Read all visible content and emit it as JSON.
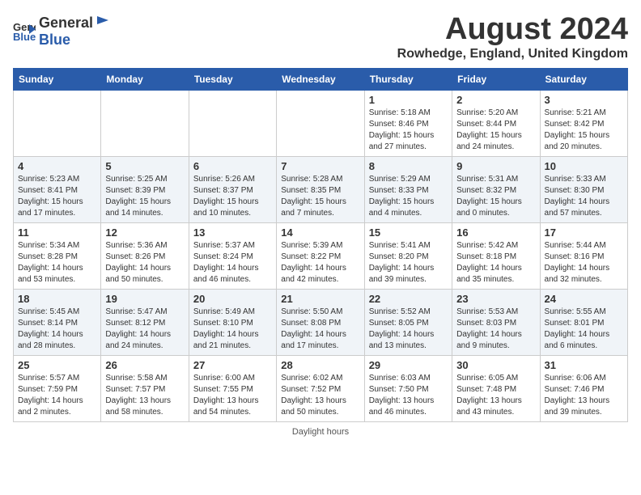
{
  "header": {
    "logo_general": "General",
    "logo_blue": "Blue",
    "month_title": "August 2024",
    "location": "Rowhedge, England, United Kingdom"
  },
  "footer": {
    "note": "Daylight hours"
  },
  "days_of_week": [
    "Sunday",
    "Monday",
    "Tuesday",
    "Wednesday",
    "Thursday",
    "Friday",
    "Saturday"
  ],
  "weeks": [
    [
      {
        "day": "",
        "info": ""
      },
      {
        "day": "",
        "info": ""
      },
      {
        "day": "",
        "info": ""
      },
      {
        "day": "",
        "info": ""
      },
      {
        "day": "1",
        "info": "Sunrise: 5:18 AM\nSunset: 8:46 PM\nDaylight: 15 hours\nand 27 minutes."
      },
      {
        "day": "2",
        "info": "Sunrise: 5:20 AM\nSunset: 8:44 PM\nDaylight: 15 hours\nand 24 minutes."
      },
      {
        "day": "3",
        "info": "Sunrise: 5:21 AM\nSunset: 8:42 PM\nDaylight: 15 hours\nand 20 minutes."
      }
    ],
    [
      {
        "day": "4",
        "info": "Sunrise: 5:23 AM\nSunset: 8:41 PM\nDaylight: 15 hours\nand 17 minutes."
      },
      {
        "day": "5",
        "info": "Sunrise: 5:25 AM\nSunset: 8:39 PM\nDaylight: 15 hours\nand 14 minutes."
      },
      {
        "day": "6",
        "info": "Sunrise: 5:26 AM\nSunset: 8:37 PM\nDaylight: 15 hours\nand 10 minutes."
      },
      {
        "day": "7",
        "info": "Sunrise: 5:28 AM\nSunset: 8:35 PM\nDaylight: 15 hours\nand 7 minutes."
      },
      {
        "day": "8",
        "info": "Sunrise: 5:29 AM\nSunset: 8:33 PM\nDaylight: 15 hours\nand 4 minutes."
      },
      {
        "day": "9",
        "info": "Sunrise: 5:31 AM\nSunset: 8:32 PM\nDaylight: 15 hours\nand 0 minutes."
      },
      {
        "day": "10",
        "info": "Sunrise: 5:33 AM\nSunset: 8:30 PM\nDaylight: 14 hours\nand 57 minutes."
      }
    ],
    [
      {
        "day": "11",
        "info": "Sunrise: 5:34 AM\nSunset: 8:28 PM\nDaylight: 14 hours\nand 53 minutes."
      },
      {
        "day": "12",
        "info": "Sunrise: 5:36 AM\nSunset: 8:26 PM\nDaylight: 14 hours\nand 50 minutes."
      },
      {
        "day": "13",
        "info": "Sunrise: 5:37 AM\nSunset: 8:24 PM\nDaylight: 14 hours\nand 46 minutes."
      },
      {
        "day": "14",
        "info": "Sunrise: 5:39 AM\nSunset: 8:22 PM\nDaylight: 14 hours\nand 42 minutes."
      },
      {
        "day": "15",
        "info": "Sunrise: 5:41 AM\nSunset: 8:20 PM\nDaylight: 14 hours\nand 39 minutes."
      },
      {
        "day": "16",
        "info": "Sunrise: 5:42 AM\nSunset: 8:18 PM\nDaylight: 14 hours\nand 35 minutes."
      },
      {
        "day": "17",
        "info": "Sunrise: 5:44 AM\nSunset: 8:16 PM\nDaylight: 14 hours\nand 32 minutes."
      }
    ],
    [
      {
        "day": "18",
        "info": "Sunrise: 5:45 AM\nSunset: 8:14 PM\nDaylight: 14 hours\nand 28 minutes."
      },
      {
        "day": "19",
        "info": "Sunrise: 5:47 AM\nSunset: 8:12 PM\nDaylight: 14 hours\nand 24 minutes."
      },
      {
        "day": "20",
        "info": "Sunrise: 5:49 AM\nSunset: 8:10 PM\nDaylight: 14 hours\nand 21 minutes."
      },
      {
        "day": "21",
        "info": "Sunrise: 5:50 AM\nSunset: 8:08 PM\nDaylight: 14 hours\nand 17 minutes."
      },
      {
        "day": "22",
        "info": "Sunrise: 5:52 AM\nSunset: 8:05 PM\nDaylight: 14 hours\nand 13 minutes."
      },
      {
        "day": "23",
        "info": "Sunrise: 5:53 AM\nSunset: 8:03 PM\nDaylight: 14 hours\nand 9 minutes."
      },
      {
        "day": "24",
        "info": "Sunrise: 5:55 AM\nSunset: 8:01 PM\nDaylight: 14 hours\nand 6 minutes."
      }
    ],
    [
      {
        "day": "25",
        "info": "Sunrise: 5:57 AM\nSunset: 7:59 PM\nDaylight: 14 hours\nand 2 minutes."
      },
      {
        "day": "26",
        "info": "Sunrise: 5:58 AM\nSunset: 7:57 PM\nDaylight: 13 hours\nand 58 minutes."
      },
      {
        "day": "27",
        "info": "Sunrise: 6:00 AM\nSunset: 7:55 PM\nDaylight: 13 hours\nand 54 minutes."
      },
      {
        "day": "28",
        "info": "Sunrise: 6:02 AM\nSunset: 7:52 PM\nDaylight: 13 hours\nand 50 minutes."
      },
      {
        "day": "29",
        "info": "Sunrise: 6:03 AM\nSunset: 7:50 PM\nDaylight: 13 hours\nand 46 minutes."
      },
      {
        "day": "30",
        "info": "Sunrise: 6:05 AM\nSunset: 7:48 PM\nDaylight: 13 hours\nand 43 minutes."
      },
      {
        "day": "31",
        "info": "Sunrise: 6:06 AM\nSunset: 7:46 PM\nDaylight: 13 hours\nand 39 minutes."
      }
    ]
  ]
}
